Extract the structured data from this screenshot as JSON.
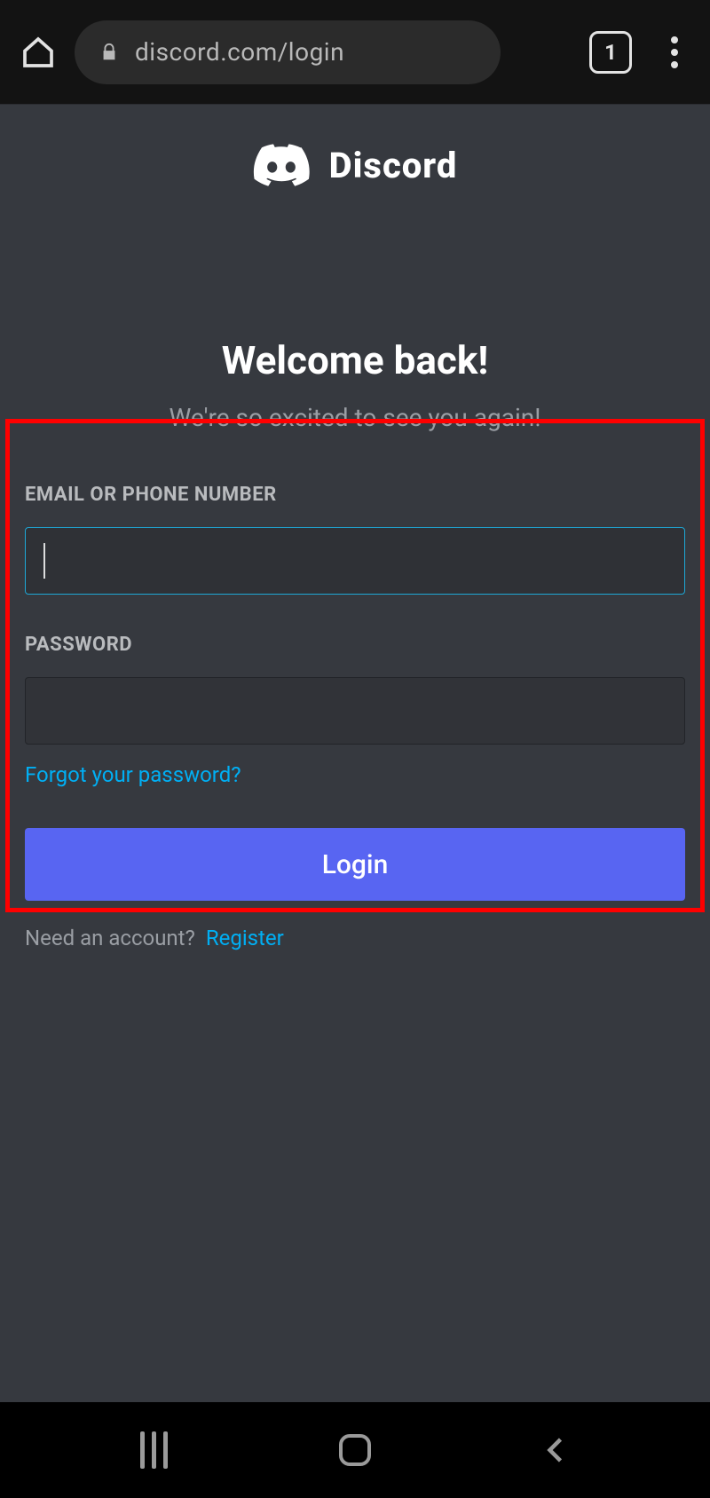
{
  "browser": {
    "url": "discord.com/login",
    "tab_count": "1"
  },
  "brand": {
    "name": "Discord"
  },
  "login": {
    "title": "Welcome back!",
    "subtitle": "We're so excited to see you again!",
    "email_label": "EMAIL OR PHONE NUMBER",
    "password_label": "PASSWORD",
    "email_value": "",
    "password_value": "",
    "forgot": "Forgot your password?",
    "login_button": "Login",
    "need_account": "Need an account?",
    "register": "Register"
  }
}
